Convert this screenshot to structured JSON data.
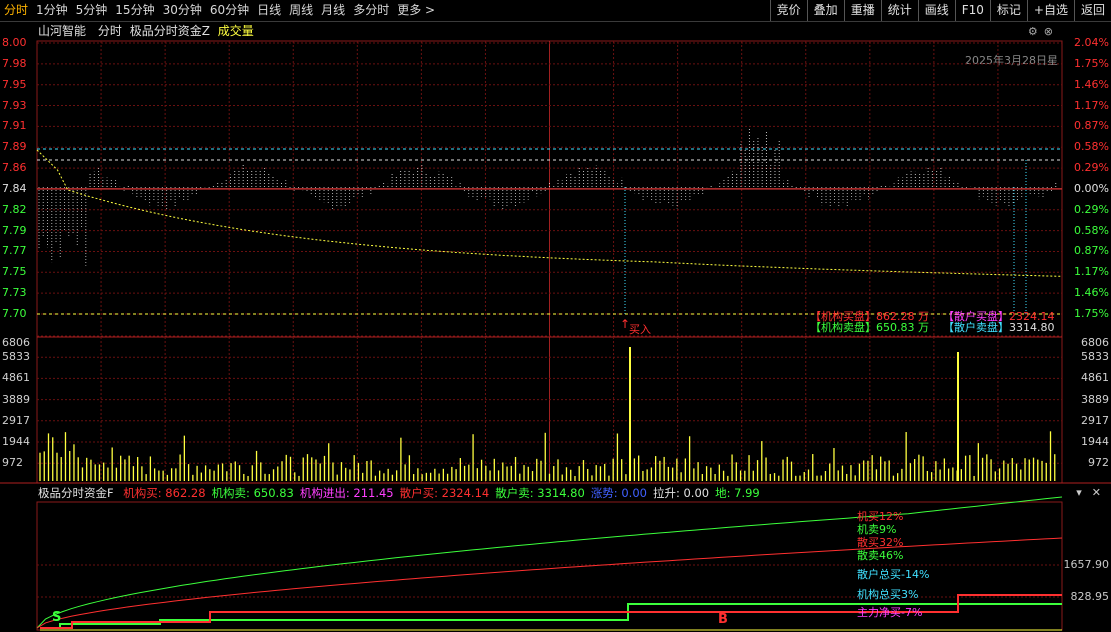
{
  "tabs": [
    "分时",
    "1分钟",
    "5分钟",
    "15分钟",
    "30分钟",
    "60分钟",
    "日线",
    "周线",
    "月线",
    "多分时",
    "更多"
  ],
  "right_tools": [
    "竞价",
    "叠加",
    "重播",
    "统计",
    "画线",
    "F10",
    "标记",
    "+自选",
    "返回"
  ],
  "header": {
    "stock": "山河智能",
    "mode": "分时",
    "indicator": "极品分时资金Z",
    "volume_label": "成交量"
  },
  "date": "2025年3月28日星",
  "colors": {
    "red": "#ff3030",
    "green": "#3cff3c",
    "yellow": "#ffff40",
    "magenta": "#ff40ff",
    "cyan": "#40e0ff",
    "grid": "#6a1010",
    "bg": "#000000"
  },
  "price_axis": {
    "left": [
      "8.00",
      "7.98",
      "7.95",
      "7.93",
      "7.91",
      "7.89",
      "7.86",
      "7.84",
      "7.82",
      "7.79",
      "7.77",
      "7.75",
      "7.73",
      "7.70"
    ],
    "right": [
      "2.04%",
      "1.75%",
      "1.46%",
      "1.17%",
      "0.87%",
      "0.58%",
      "0.29%",
      "0.00%",
      "0.29%",
      "0.58%",
      "0.87%",
      "1.17%",
      "1.46%",
      "1.75%"
    ]
  },
  "volume_axis": {
    "labels": [
      "6806",
      "5833",
      "4861",
      "3889",
      "2917",
      "1944",
      "972"
    ]
  },
  "buy_marker": "买入",
  "summary": {
    "inst_buy_label": "【机构买盘】",
    "inst_buy_value": "862.28 万",
    "retail_buy_label": "【散户买盘】",
    "retail_buy_value": "2324.14",
    "inst_sell_label": "【机构卖盘】",
    "inst_sell_value": "650.83 万",
    "retail_sell_label": "【散户卖盘】",
    "retail_sell_value": "3314.80"
  },
  "indicator_header": {
    "name": "极品分时资金F",
    "items": [
      {
        "label": "机构买:",
        "value": "862.28",
        "color": "#ff3030"
      },
      {
        "label": "机构卖:",
        "value": "650.83",
        "color": "#3cff3c"
      },
      {
        "label": "机构进出:",
        "value": "211.45",
        "color": "#ff40ff"
      },
      {
        "label": "散户买:",
        "value": "2324.14",
        "color": "#ff3030"
      },
      {
        "label": "散户卖:",
        "value": "3314.80",
        "color": "#3cff3c"
      },
      {
        "label": "涨势:",
        "value": "0.00",
        "color": "#4060ff"
      },
      {
        "label": "拉升:",
        "value": "0.00",
        "color": "#e0e0e0"
      },
      {
        "label": "地:",
        "value": "7.99",
        "color": "#3cff3c"
      }
    ]
  },
  "indicator_axis": [
    "1657.90",
    "828.95"
  ],
  "indicator_labels": [
    {
      "text": "机买12%",
      "color": "#ff3030"
    },
    {
      "text": "机卖9%",
      "color": "#3cff3c"
    },
    {
      "text": "散买32%",
      "color": "#ff3030"
    },
    {
      "text": "散卖46%",
      "color": "#3cff3c"
    },
    {
      "text": "散户总买-14%",
      "color": "#40e0ff"
    },
    {
      "text": "机构总买3%",
      "color": "#40e0ff"
    },
    {
      "text": "主力净买-7%",
      "color": "#ff40ff"
    }
  ],
  "signal_s": "S",
  "signal_b": "B"
}
